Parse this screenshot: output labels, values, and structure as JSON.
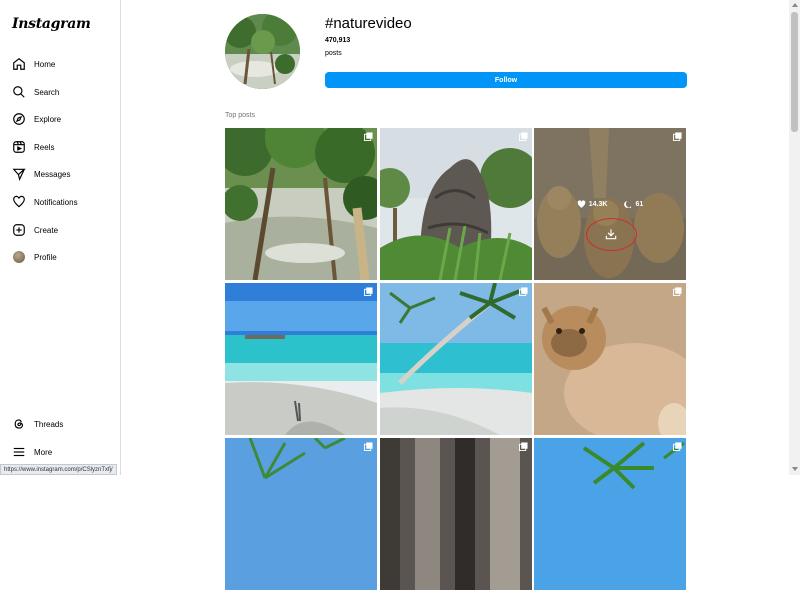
{
  "app": {
    "logo_text": "Instagram"
  },
  "sidebar": {
    "items": [
      {
        "label": "Home",
        "icon": "home-icon"
      },
      {
        "label": "Search",
        "icon": "search-icon"
      },
      {
        "label": "Explore",
        "icon": "compass-icon"
      },
      {
        "label": "Reels",
        "icon": "reels-icon"
      },
      {
        "label": "Messages",
        "icon": "send-icon"
      },
      {
        "label": "Notifications",
        "icon": "heart-icon"
      },
      {
        "label": "Create",
        "icon": "plus-square-icon"
      },
      {
        "label": "Profile",
        "icon": "avatar"
      }
    ],
    "bottom_items": [
      {
        "label": "Threads",
        "icon": "threads-icon"
      },
      {
        "label": "More",
        "icon": "menu-icon"
      }
    ]
  },
  "status_url": "https://www.instagram.com/p/CSlyznTxfj/",
  "header": {
    "hashtag": "#naturevideo",
    "post_count": "470,913",
    "posts_label": "posts",
    "follow_label": "Follow"
  },
  "top_posts": {
    "section_label": "Top posts",
    "hovered_post": {
      "likes": "14.3K",
      "comments": "61"
    }
  },
  "colors": {
    "follow_button": "#0095f6",
    "highlight_ring": "#d22a2a"
  }
}
